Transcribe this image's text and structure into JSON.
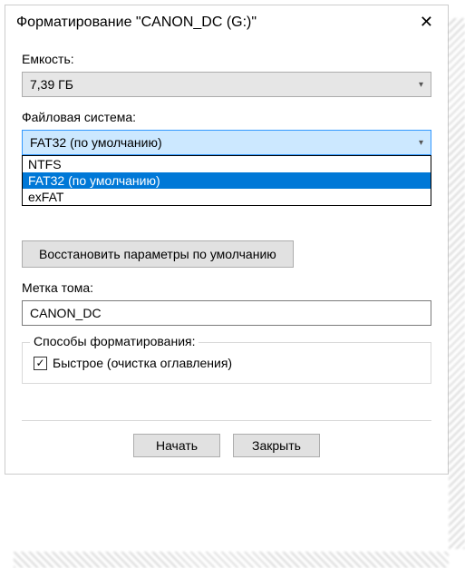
{
  "window": {
    "title": "Форматирование \"CANON_DC (G:)\""
  },
  "capacity": {
    "label": "Емкость:",
    "value": "7,39 ГБ"
  },
  "filesystem": {
    "label": "Файловая система:",
    "selected": "FAT32 (по умолчанию)",
    "options": [
      "NTFS",
      "FAT32 (по умолчанию)",
      "exFAT"
    ]
  },
  "restore_defaults": "Восстановить параметры по умолчанию",
  "volume_label": {
    "label": "Метка тома:",
    "value": "CANON_DC"
  },
  "format_options": {
    "legend": "Способы форматирования:",
    "quick_label": "Быстрое (очистка оглавления)",
    "quick_checked": true
  },
  "buttons": {
    "start": "Начать",
    "close": "Закрыть"
  }
}
